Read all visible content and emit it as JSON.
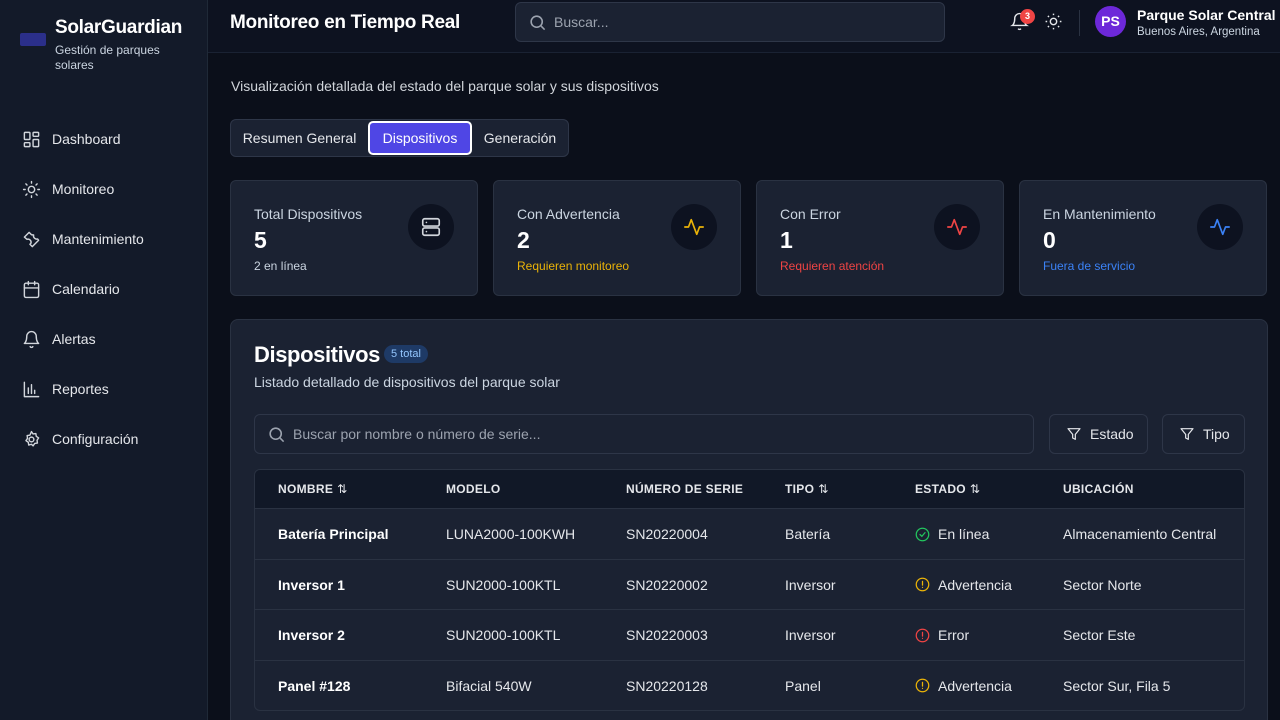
{
  "brand": {
    "title": "SolarGuardian",
    "subtitle": "Gestión de parques solares"
  },
  "sidebar": {
    "items": [
      {
        "label": "Dashboard",
        "icon": "dashboard-icon"
      },
      {
        "label": "Monitoreo",
        "icon": "sun-icon"
      },
      {
        "label": "Mantenimiento",
        "icon": "wrench-icon"
      },
      {
        "label": "Calendario",
        "icon": "calendar-icon"
      },
      {
        "label": "Alertas",
        "icon": "bell-icon"
      },
      {
        "label": "Reportes",
        "icon": "bar-chart-icon"
      },
      {
        "label": "Configuración",
        "icon": "gear-icon"
      }
    ]
  },
  "header": {
    "title": "Monitoreo en Tiempo Real",
    "search_placeholder": "Buscar...",
    "notification_count": "3",
    "profile": {
      "initials": "PS",
      "name": "Parque Solar Central",
      "location": "Buenos Aires, Argentina"
    }
  },
  "main": {
    "subtitle": "Visualización detallada del estado del parque solar y sus dispositivos",
    "tabs": [
      {
        "label": "Resumen General",
        "active": false
      },
      {
        "label": "Dispositivos",
        "active": true
      },
      {
        "label": "Generación",
        "active": false
      }
    ],
    "cards": [
      {
        "label": "Total Dispositivos",
        "value": "5",
        "note": "2 en línea",
        "note_color": "#cbd5e1",
        "icon": "server-icon",
        "icon_color": "#d1d5db"
      },
      {
        "label": "Con Advertencia",
        "value": "2",
        "note": "Requieren monitoreo",
        "note_color": "#eab308",
        "icon": "activity-icon",
        "icon_color": "#eab308"
      },
      {
        "label": "Con Error",
        "value": "1",
        "note": "Requieren atención",
        "note_color": "#ef4444",
        "icon": "activity-icon",
        "icon_color": "#ef4444"
      },
      {
        "label": "En Mantenimiento",
        "value": "0",
        "note": "Fuera de servicio",
        "note_color": "#3b82f6",
        "icon": "activity-icon",
        "icon_color": "#3b82f6"
      }
    ],
    "devices": {
      "title": "Dispositivos",
      "count_badge": "5 total",
      "subtitle": "Listado detallado de dispositivos del parque solar",
      "search_placeholder": "Buscar por nombre o número de serie...",
      "filter_estado": "Estado",
      "filter_tipo": "Tipo",
      "columns": [
        "NOMBRE",
        "MODELO",
        "NÚMERO DE SERIE",
        "TIPO",
        "ESTADO",
        "UBICACIÓN"
      ],
      "rows": [
        {
          "name": "Batería Principal",
          "model": "LUNA2000-100KWH",
          "serial": "SN20220004",
          "type": "Batería",
          "status": "En línea",
          "status_kind": "ok",
          "location": "Almacenamiento Central"
        },
        {
          "name": "Inversor 1",
          "model": "SUN2000-100KTL",
          "serial": "SN20220002",
          "type": "Inversor",
          "status": "Advertencia",
          "status_kind": "warn",
          "location": "Sector Norte"
        },
        {
          "name": "Inversor 2",
          "model": "SUN2000-100KTL",
          "serial": "SN20220003",
          "type": "Inversor",
          "status": "Error",
          "status_kind": "error",
          "location": "Sector Este"
        },
        {
          "name": "Panel #128",
          "model": "Bifacial 540W",
          "serial": "SN20220128",
          "type": "Panel",
          "status": "Advertencia",
          "status_kind": "warn",
          "location": "Sector Sur, Fila 5"
        }
      ]
    }
  },
  "colors": {
    "accent": "#4f46e5",
    "ok": "#22c55e",
    "warn": "#eab308",
    "error": "#ef4444",
    "info": "#3b82f6"
  }
}
